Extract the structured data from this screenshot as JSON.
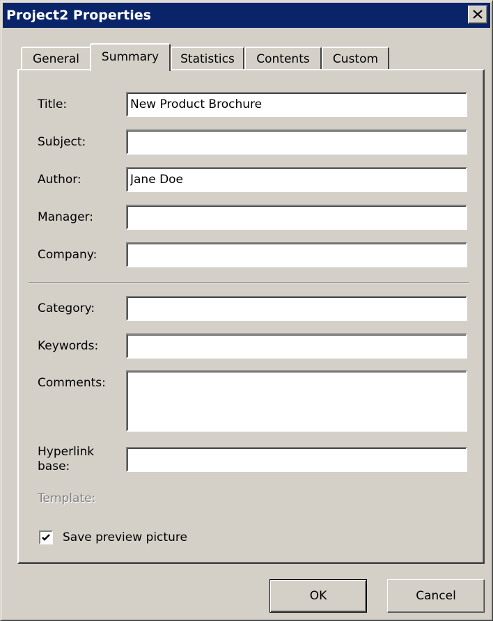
{
  "window": {
    "title": "Project2 Properties"
  },
  "tabs": [
    {
      "label": "General"
    },
    {
      "label": "Summary"
    },
    {
      "label": "Statistics"
    },
    {
      "label": "Contents"
    },
    {
      "label": "Custom"
    }
  ],
  "active_tab": "Summary",
  "fields": {
    "title": {
      "label": "Title:",
      "value": "New Product Brochure"
    },
    "subject": {
      "label": "Subject:",
      "value": ""
    },
    "author": {
      "label": "Author:",
      "value": "Jane Doe"
    },
    "manager": {
      "label": "Manager:",
      "value": ""
    },
    "company": {
      "label": "Company:",
      "value": ""
    },
    "category": {
      "label": "Category:",
      "value": ""
    },
    "keywords": {
      "label": "Keywords:",
      "value": ""
    },
    "comments": {
      "label": "Comments:",
      "value": ""
    },
    "hyperlink_base": {
      "label_line1": "Hyperlink",
      "label_line2": "base:",
      "value": ""
    },
    "template": {
      "label": "Template:"
    }
  },
  "save_preview": {
    "label": "Save preview picture",
    "checked": true
  },
  "buttons": {
    "ok": "OK",
    "cancel": "Cancel"
  },
  "colors": {
    "titlebar": "#0a246a",
    "face": "#d4d0c8"
  }
}
